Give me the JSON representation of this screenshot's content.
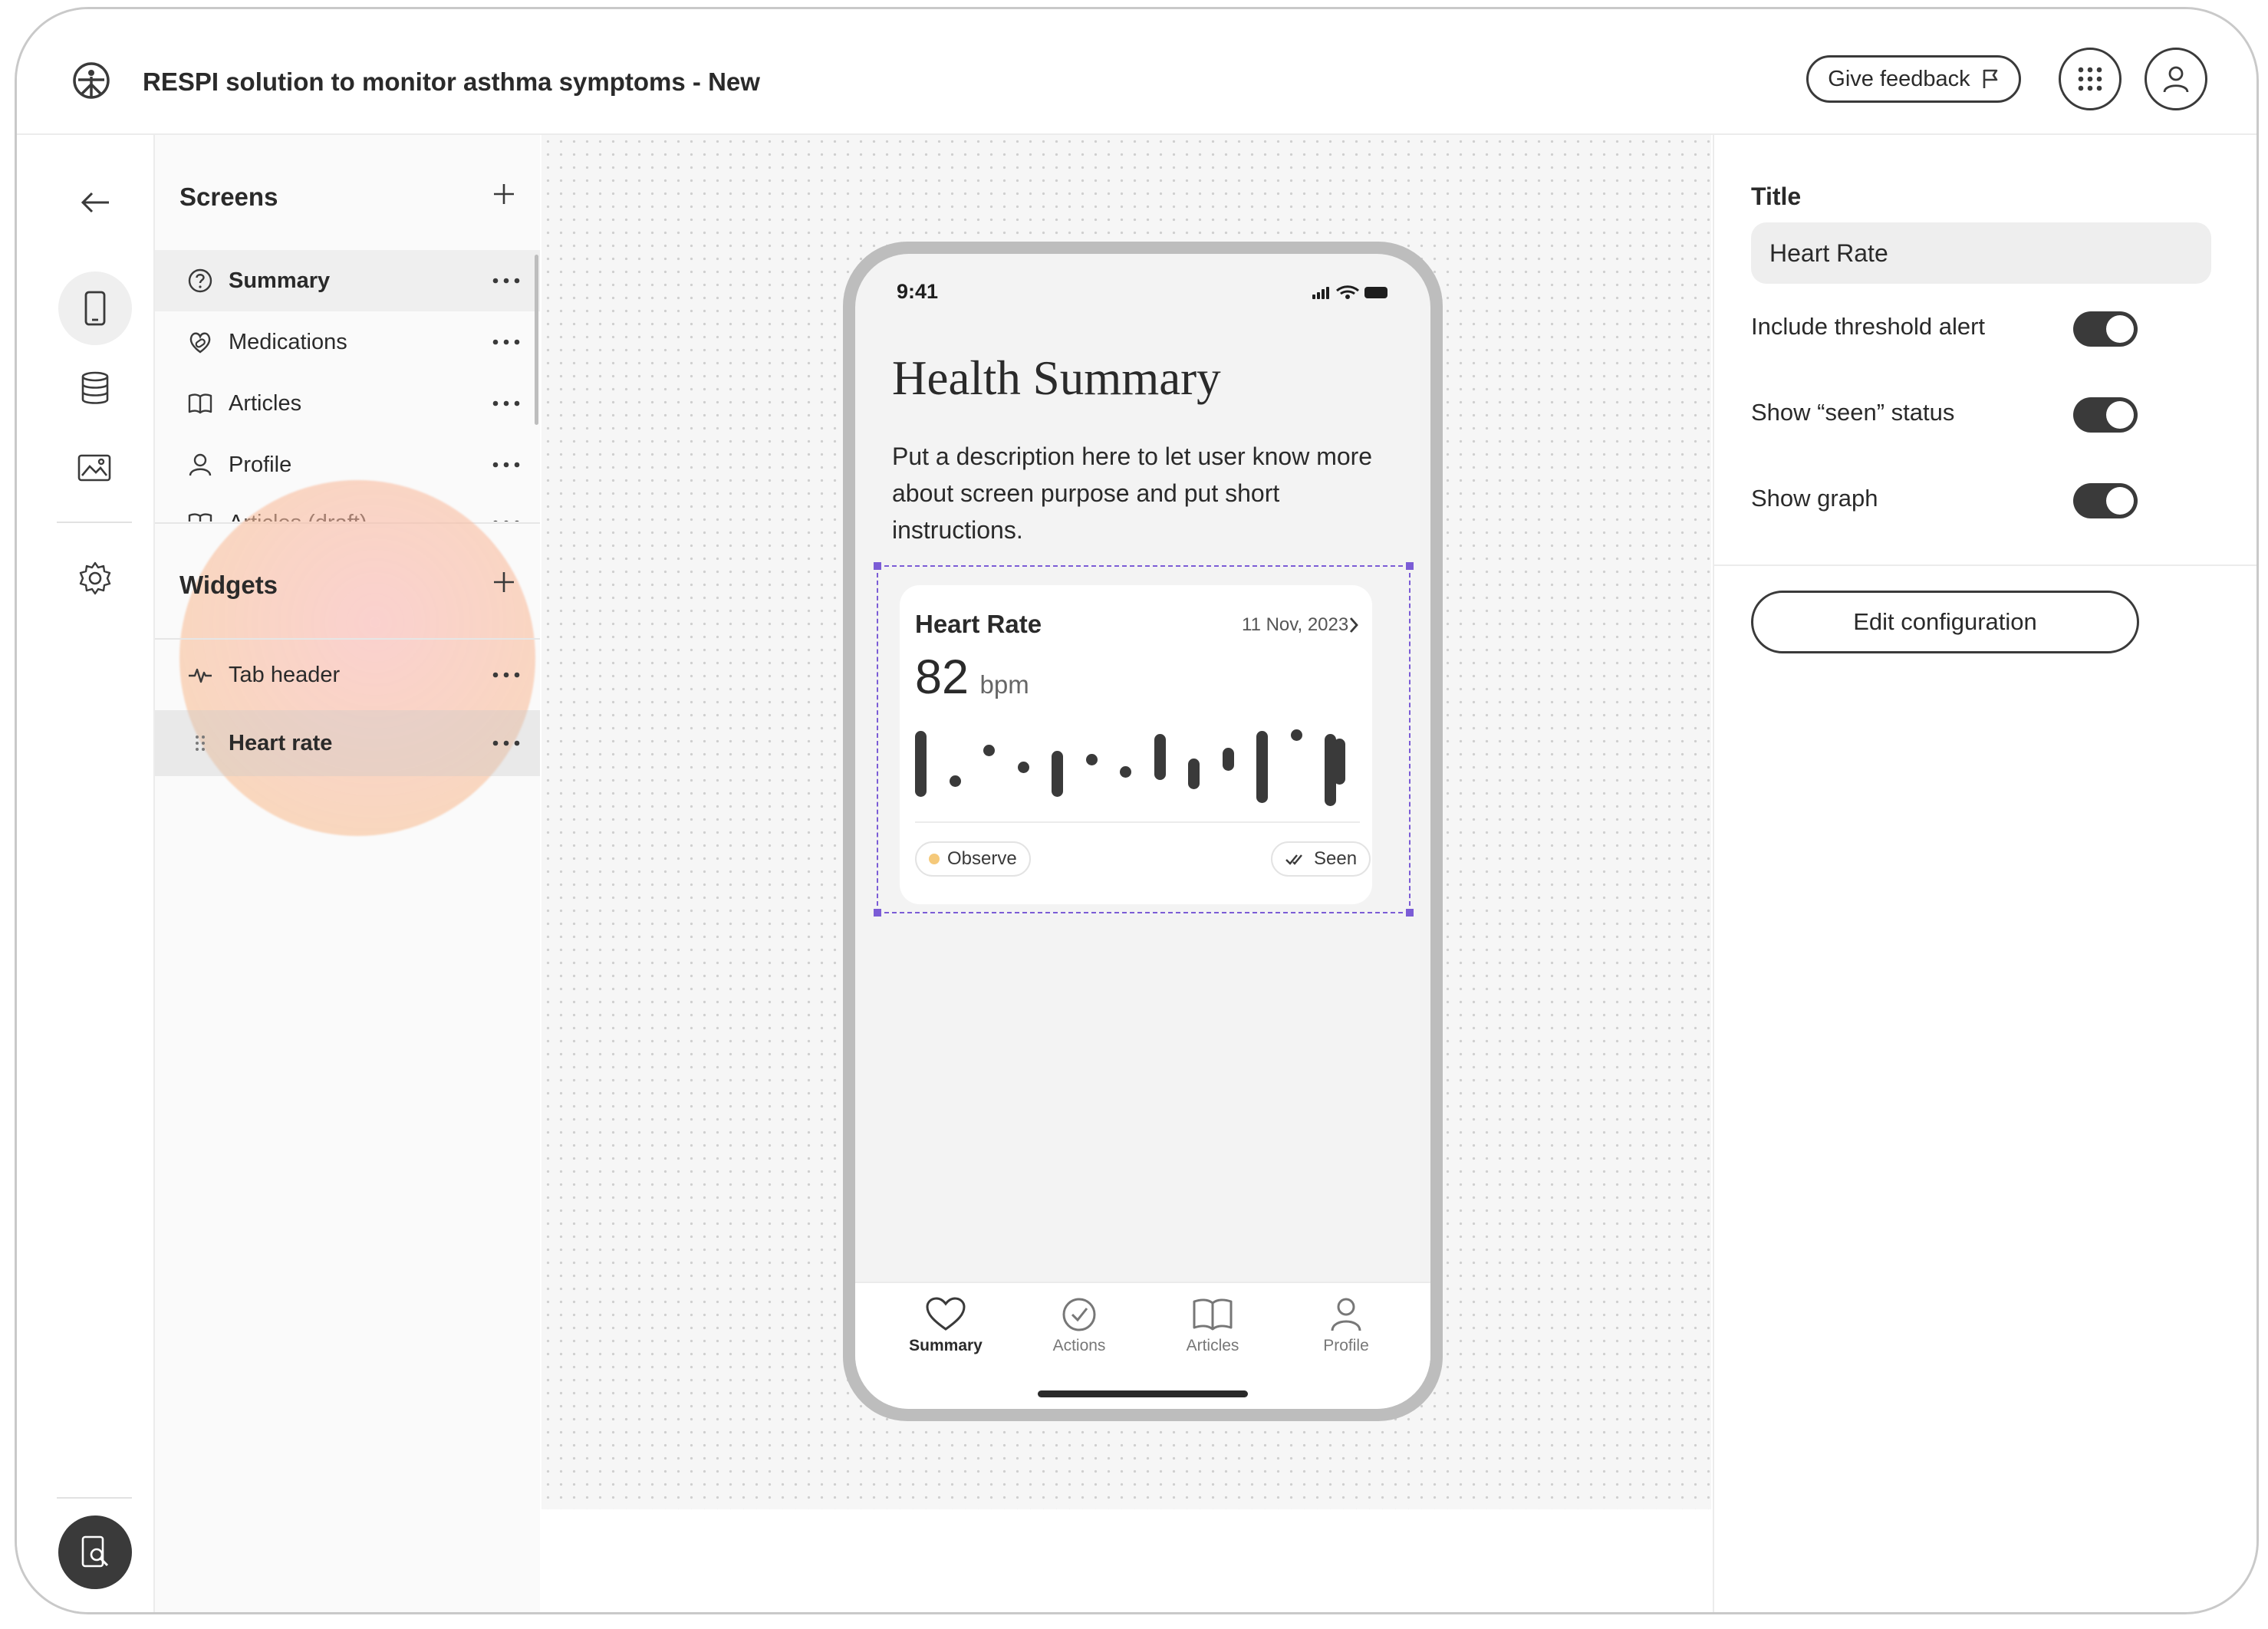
{
  "header": {
    "title": "RESPI solution to monitor asthma symptoms - New",
    "feedback_label": "Give feedback"
  },
  "screens": {
    "title": "Screens",
    "items": [
      {
        "label": "Summary",
        "icon": "help-circle-icon"
      },
      {
        "label": "Medications",
        "icon": "pills-icon"
      },
      {
        "label": "Articles",
        "icon": "book-icon"
      },
      {
        "label": "Profile",
        "icon": "person-icon"
      },
      {
        "label": "Articles (draft)",
        "icon": "book-icon"
      }
    ]
  },
  "widgets": {
    "title": "Widgets",
    "items": [
      {
        "label": "Tab header",
        "icon": "pulse-icon"
      },
      {
        "label": "Heart rate",
        "icon": "drag-handle-icon"
      }
    ]
  },
  "phone": {
    "time": "9:41",
    "heading": "Health Summary",
    "description": "Put a description here to let user know more about screen purpose and put short instructions.",
    "card": {
      "title": "Heart Rate",
      "date": "11 Nov, 2023",
      "value": "82",
      "unit": "bpm",
      "status": "Observe",
      "seen": "Seen"
    },
    "tabs": [
      "Summary",
      "Actions",
      "Articles",
      "Profile"
    ]
  },
  "properties": {
    "title_label": "Title",
    "title_value": "Heart Rate",
    "toggles": [
      {
        "label": "Include threshold alert",
        "on": true
      },
      {
        "label": "Show “seen” status",
        "on": true
      },
      {
        "label": "Show graph",
        "on": true
      }
    ],
    "edit_label": "Edit configuration"
  },
  "colors": {
    "accent_dark": "#3a3a3a",
    "selection": "#7b5cd6",
    "observe_dot": "#f5c97a"
  }
}
